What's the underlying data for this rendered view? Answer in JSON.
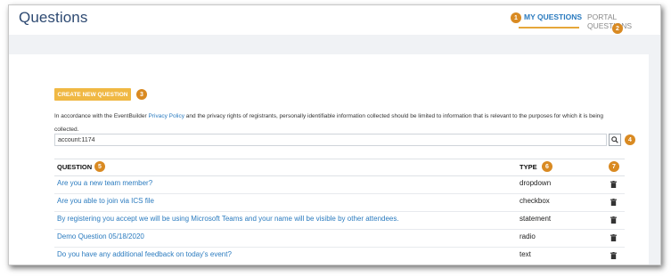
{
  "header": {
    "title": "Questions",
    "tabs": [
      {
        "label": "MY QUESTIONS",
        "active": true
      },
      {
        "label": "PORTAL QUESTIONS",
        "active": false
      }
    ]
  },
  "colors": {
    "accent": "#2b7bbf",
    "title": "#2e4a72",
    "button": "#f0b843",
    "badge": "#d98a22",
    "tab_underline": "#e6a73a"
  },
  "badges": [
    "1",
    "2",
    "3",
    "4",
    "5",
    "6",
    "7"
  ],
  "create_button": {
    "label": "CREATE NEW QUESTION"
  },
  "notice": {
    "prefix": "In accordance with the EventBuilder ",
    "link": "Privacy Policy",
    "suffix": " and the privacy rights of registrants, personally identifiable information collected should be limited to information that is relevant to the purposes for which it is being collected."
  },
  "search": {
    "value": "account:1174",
    "icon": "search-icon"
  },
  "table": {
    "columns": {
      "question": "QUESTION",
      "type": "TYPE"
    },
    "rows": [
      {
        "question": "Are you a new team member?",
        "type": "dropdown"
      },
      {
        "question": "Are you able to join via ICS file",
        "type": "checkbox"
      },
      {
        "question": "By registering you accept we will be using Microsoft Teams and your name will be visible by other attendees.",
        "type": "statement"
      },
      {
        "question": "Demo Question 05/18/2020",
        "type": "radio"
      },
      {
        "question": "Do you have any additional feedback on today's event?",
        "type": "text"
      }
    ],
    "row_action_icon": "trash-icon"
  }
}
